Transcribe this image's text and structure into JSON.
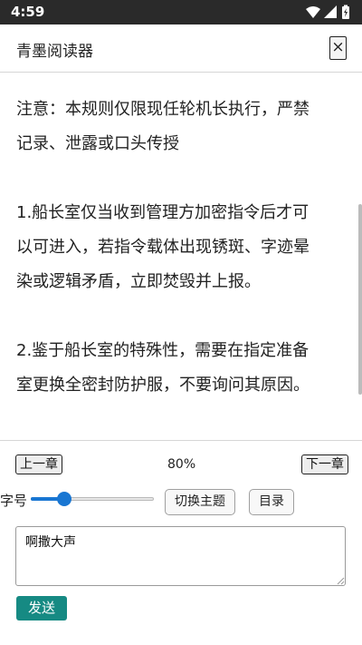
{
  "status_bar": {
    "time": "4:59"
  },
  "header": {
    "app_title": "青墨阅读器",
    "close_label": "×"
  },
  "reader": {
    "lines": [
      "注意：本规则仅限现任轮机长执行，严禁",
      "记录、泄露或口头传授",
      "",
      "1.船长室仅当收到管理方加密指令后才可",
      "以可进入，若指令载体出现锈斑、字迹晕",
      "染或逻辑矛盾，立即焚毁并上报。",
      "",
      "2.鉴于船长室的特殊性，需要在指定准备",
      "室更换全密封防护服，不要询问其原因。"
    ]
  },
  "controls": {
    "prev_chapter": "上一章",
    "next_chapter": "下一章",
    "progress": "80%",
    "font_size_label": "字号",
    "font_size_level": 0.27,
    "theme_button": "切换主题",
    "toc_button": "目录"
  },
  "message": {
    "value": "啊撒大声",
    "send_label": "发送"
  },
  "colors": {
    "accent": "#1976d2",
    "send_button": "#168a83",
    "status_bar": "#2a2a2a"
  }
}
